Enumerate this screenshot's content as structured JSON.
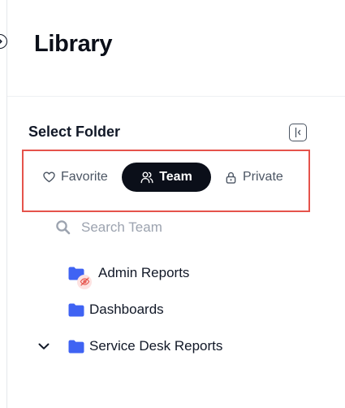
{
  "header": {
    "title": "Library"
  },
  "folder_panel": {
    "title": "Select Folder",
    "tabs": [
      {
        "label": "Favorite",
        "icon": "heart-icon",
        "active": false
      },
      {
        "label": "Team",
        "icon": "users-icon",
        "active": true
      },
      {
        "label": "Private",
        "icon": "lock-icon",
        "active": false
      }
    ],
    "search": {
      "placeholder": "Search Team"
    },
    "folders": [
      {
        "label": "Admin Reports",
        "icon": "folder-icon",
        "badge": "eye-off-icon"
      },
      {
        "label": "Dashboards",
        "icon": "folder-icon"
      },
      {
        "label": "Service Desk Reports",
        "icon": "folder-icon",
        "expand_icon": "chevron-down-icon"
      }
    ]
  },
  "colors": {
    "accent": "#0b0f19",
    "folder": "#3f63f3",
    "highlight_border": "#e5534b",
    "hidden_badge": "#e5534b"
  }
}
